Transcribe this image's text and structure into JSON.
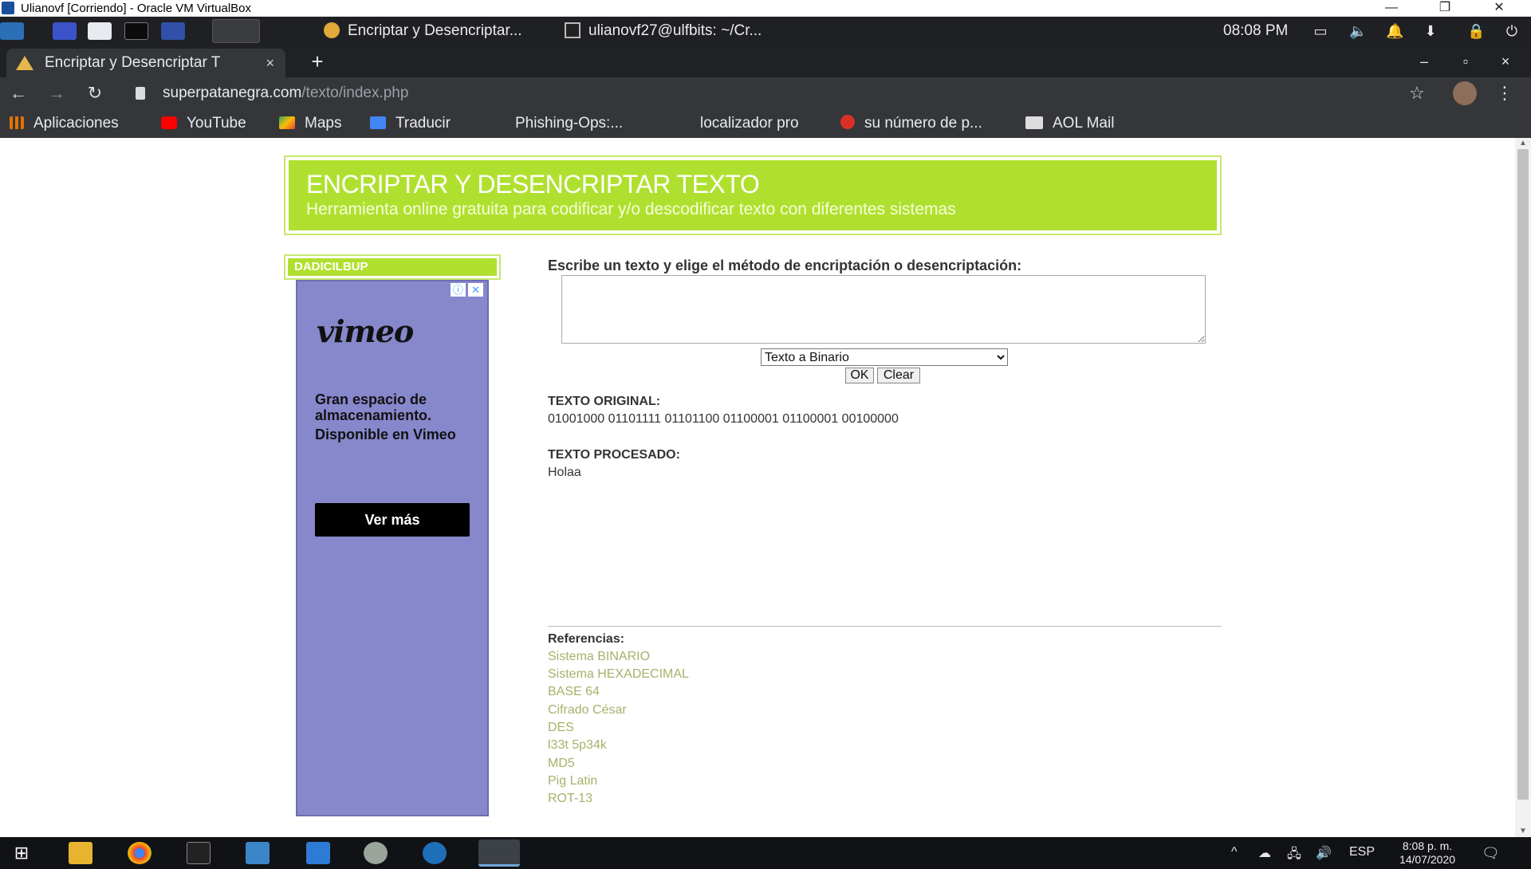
{
  "vbox": {
    "title": "Ulianovf [Corriendo] - Oracle VM VirtualBox",
    "minimize": "—",
    "restore": "❐",
    "close": "✕"
  },
  "guest_panel": {
    "task_browser": "Encriptar y Desencriptar...",
    "task_terminal": "ulianovf27@ulfbits: ~/Cr...",
    "clock": "08:08 PM"
  },
  "browser": {
    "tab_title": "Encriptar y Desencriptar T",
    "tab_close": "×",
    "new_tab": "+",
    "win_min": "–",
    "win_max": "▫",
    "win_close": "×",
    "back": "←",
    "forward": "→",
    "reload": "↻",
    "url_host": "superpatanegra.com",
    "url_path": "/texto/index.php",
    "star": "☆",
    "menu": "⋮"
  },
  "bookmarks": [
    {
      "label": "Aplicaciones",
      "icon": "apps-grid-icon"
    },
    {
      "label": "YouTube",
      "icon": "youtube-icon"
    },
    {
      "label": "Maps",
      "icon": "maps-icon"
    },
    {
      "label": "Traducir",
      "icon": "translate-icon"
    },
    {
      "label": "Phishing-Ops:...",
      "icon": ""
    },
    {
      "label": "localizador pro",
      "icon": ""
    },
    {
      "label": "su número de p...",
      "icon": "red-circle-icon"
    },
    {
      "label": "AOL Mail",
      "icon": "aol-icon"
    }
  ],
  "page": {
    "title": "ENCRIPTAR Y DESENCRIPTAR TEXTO",
    "subtitle": "Herramienta online gratuita para codificar y/o descodificar texto con diferentes sistemas",
    "side_label": "DADICILBUP",
    "ad": {
      "logo": "vimeo",
      "line1": "Gran espacio de almacenamiento.",
      "line2": "Disponible en Vimeo",
      "button": "Ver más",
      "info": "ⓘ",
      "close": "✕"
    },
    "instructions": "Escribe un texto y elige el método de encriptación o desencriptación:",
    "input_value": "",
    "select_value": "Texto a Binario",
    "ok_label": "OK",
    "clear_label": "Clear",
    "original_label": "TEXTO ORIGINAL:",
    "original_value": "01001000 01101111 01101100 01100001 01100001 00100000",
    "processed_label": "TEXTO PROCESADO:",
    "processed_value": "Holaa",
    "references_label": "Referencias:",
    "references": [
      "Sistema BINARIO",
      "Sistema HEXADECIMAL",
      "BASE 64",
      "Cifrado César",
      "DES",
      "l33t 5p34k",
      "MD5",
      "Pig Latin",
      "ROT-13"
    ]
  },
  "host_taskbar": {
    "lang": "ESP",
    "time": "8:08 p. m.",
    "date": "14/07/2020"
  },
  "colors": {
    "header_green": "#b0e02f",
    "link_olive": "#a4b36a",
    "ad_purple": "#8787cc"
  }
}
